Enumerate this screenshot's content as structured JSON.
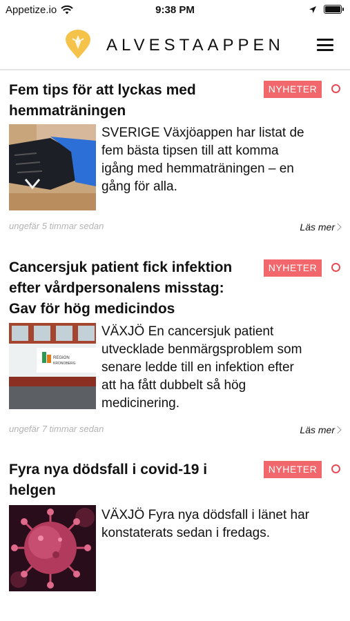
{
  "status_bar": {
    "carrier": "Appetize.io",
    "time": "9:38 PM"
  },
  "header": {
    "title": "ALVESTAAPPEN"
  },
  "colors": {
    "badge": "#f1676b",
    "logo": "#f5c24a"
  },
  "articles": [
    {
      "title_lines": [
        "Fem tips för att lyckas med",
        "hemmaträningen"
      ],
      "badge": "NYHETER",
      "excerpt_lines": [
        "SVERIGE Växjöappen har listat de",
        "fem bästa tipsen till att komma",
        "igång med hemmaträningen – en",
        "gång för alla."
      ],
      "time_ago": "ungefär 5 timmar sedan",
      "read_more": "Läs mer"
    },
    {
      "title_lines": [
        "Cancersjuk patient fick infektion",
        "efter vårdpersonalens misstag:",
        "Gav för hög medicindos"
      ],
      "badge": "NYHETER",
      "excerpt_lines": [
        "VÄXJÖ En cancersjuk patient",
        "utvecklade benmärgsproblem som",
        "senare ledde till en infektion efter",
        "att ha fått dubbelt så hög",
        "medicinering."
      ],
      "time_ago": "ungefär 7 timmar sedan",
      "read_more": "Läs mer",
      "image_sign": [
        "REGION",
        "KRONOBERG"
      ]
    },
    {
      "title_lines": [
        "Fyra nya dödsfall i covid-19 i",
        "helgen"
      ],
      "badge": "NYHETER",
      "excerpt_lines": [
        "VÄXJÖ Fyra nya dödsfall i länet har",
        "konstaterats sedan i fredags."
      ]
    }
  ]
}
